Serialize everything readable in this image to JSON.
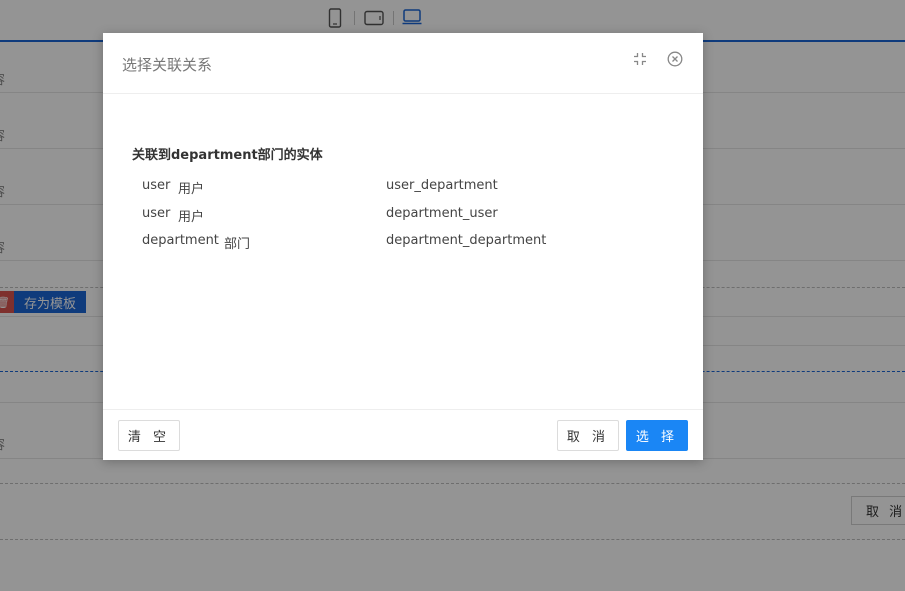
{
  "background": {
    "row_label": "容",
    "save_template_label": "存为模板",
    "delete_glyph": "🗑",
    "cancel_label": "取 消"
  },
  "dialog": {
    "title": "选择关联关系",
    "section_title": "关联到department部门的实体",
    "relations": [
      {
        "entity": "user",
        "label": "用户",
        "relation": "user_department"
      },
      {
        "entity": "user",
        "label": "用户",
        "relation": "department_user"
      },
      {
        "entity": "department",
        "label": "部门",
        "relation": "department_department"
      }
    ],
    "footer": {
      "clear_label": "清 空",
      "cancel_label": "取 消",
      "select_label": "选 择"
    },
    "icons": {
      "maximize": "maximize-icon",
      "close": "close-circle-icon"
    }
  },
  "colors": {
    "accent": "#1a86f5",
    "topbar_accent": "#1a66d6"
  }
}
